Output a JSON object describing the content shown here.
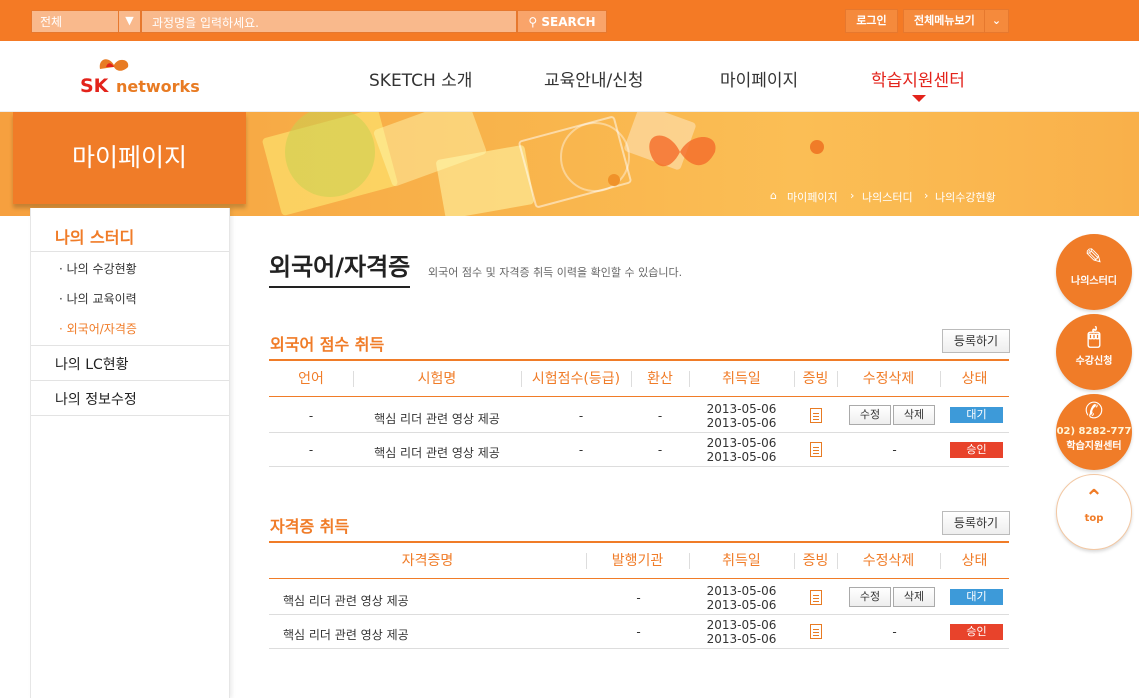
{
  "topbar": {
    "select_value": "전체",
    "search_placeholder": "과정명을 입력하세요.",
    "search_btn": "SEARCH",
    "login": "로그인",
    "all_menu": "전체메뉴보기"
  },
  "logo": {
    "sk": "SK",
    "networks": "networks"
  },
  "nav": [
    {
      "label": "SKETCH 소개"
    },
    {
      "label": "교육안내/신청"
    },
    {
      "label": "마이페이지"
    },
    {
      "label": "학습지원센터"
    }
  ],
  "page_title": "마이페이지",
  "breadcrumb": [
    "마이페이지",
    "나의스터디",
    "나의수강현황"
  ],
  "lnb": {
    "heading": "나의 스터디",
    "subs": [
      "나의 수강현황",
      "나의 교육이력",
      "외국어/자격증"
    ],
    "menu": [
      "나의 LC현황",
      "나의 정보수정"
    ]
  },
  "title": "외국어/자격증",
  "desc": "외국어 점수 및 자격증 취득 이력을 확인할 수 있습니다.",
  "lang": {
    "heading": "외국어 점수 취득",
    "reg": "등록하기",
    "cols": [
      "언어",
      "시험명",
      "시험점수(등급)",
      "환산",
      "취득일",
      "증빙",
      "수정삭제",
      "상태"
    ],
    "rows": [
      {
        "lang": "-",
        "exam": "핵심 리더 관련 영상 제공",
        "score": "-",
        "conv": "-",
        "d1": "2013-05-06",
        "d2": "2013-05-06",
        "edit": "수정",
        "del": "삭제",
        "status": "대기"
      },
      {
        "lang": "-",
        "exam": "핵심 리더 관련 영상 제공",
        "score": "-",
        "conv": "-",
        "d1": "2013-05-06",
        "d2": "2013-05-06",
        "edit": "-",
        "status": "승인"
      }
    ]
  },
  "cert": {
    "heading": "자격증 취득",
    "reg": "등록하기",
    "cols": [
      "자격증명",
      "발행기관",
      "취득일",
      "증빙",
      "수정삭제",
      "상태"
    ],
    "rows": [
      {
        "name": "핵심 리더 관련 영상 제공",
        "org": "-",
        "d1": "2013-05-06",
        "d2": "2013-05-06",
        "edit": "수정",
        "del": "삭제",
        "status": "대기"
      },
      {
        "name": "핵심 리더 관련 영상 제공",
        "org": "-",
        "d1": "2013-05-06",
        "d2": "2013-05-06",
        "edit": "-",
        "status": "승인"
      }
    ]
  },
  "quick": {
    "study": "나의스터디",
    "apply": "수강신청",
    "phone": "02) 8282-777",
    "center": "학습지원센터",
    "top": "top"
  },
  "colors": {
    "orange": "#f47a25",
    "wait": "#3d9ad9",
    "approved": "#e8432b"
  }
}
